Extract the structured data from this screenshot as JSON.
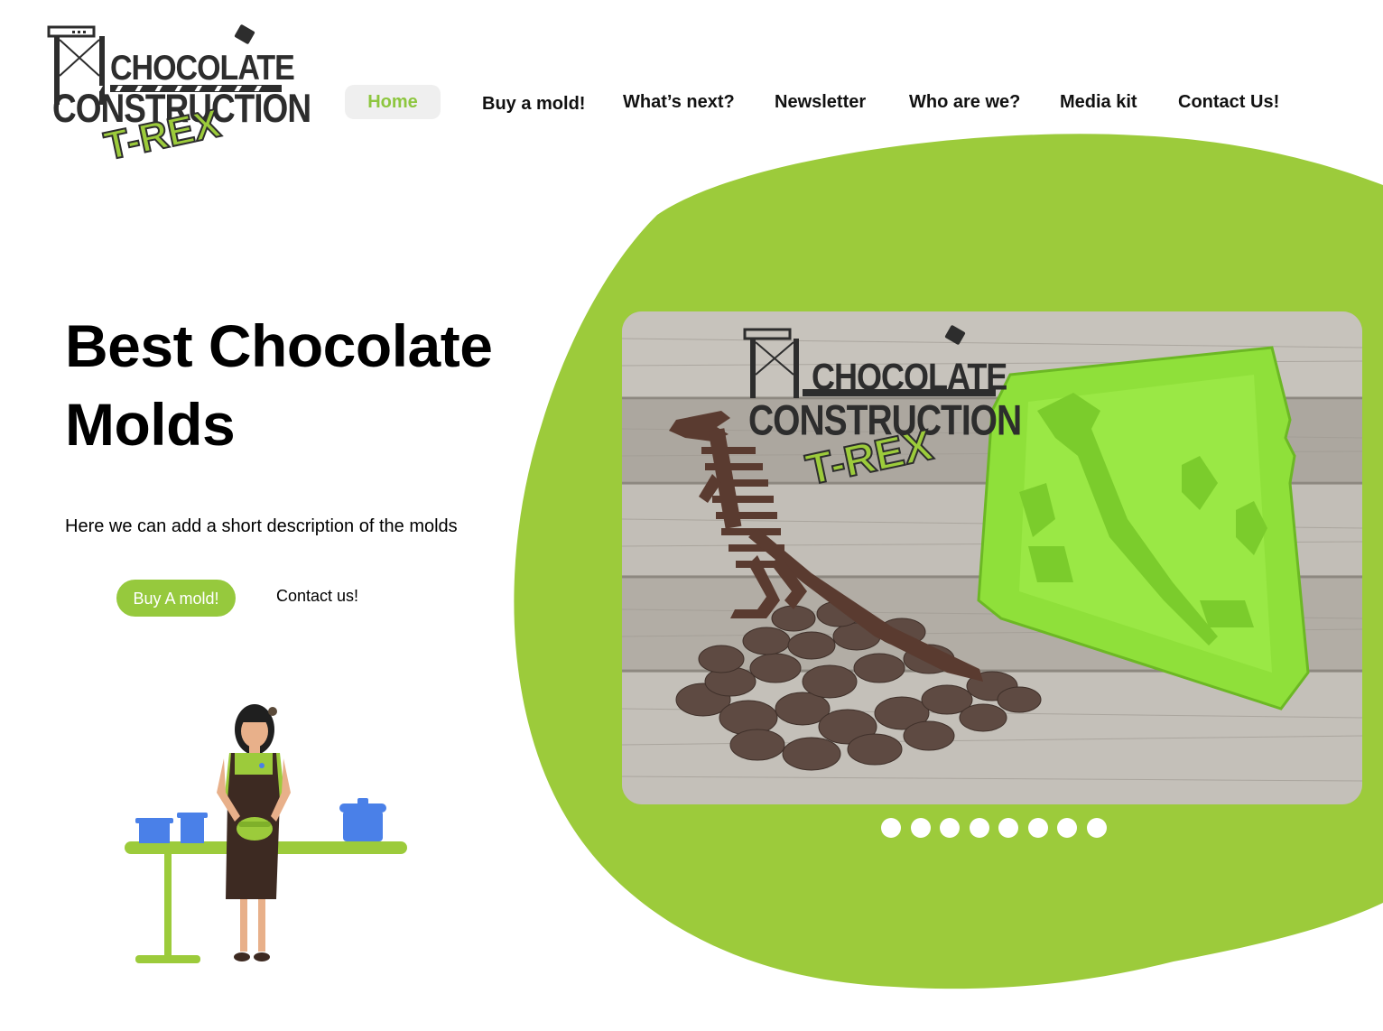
{
  "logo": {
    "line1": "CHOCOLATE",
    "line2": "CONSTRUCTION",
    "line3": "T-REX"
  },
  "nav": {
    "items": [
      {
        "label": "Home",
        "active": true
      },
      {
        "label": "Buy a mold!"
      },
      {
        "label": "What’s next?"
      },
      {
        "label": "Newsletter"
      },
      {
        "label": "Who are we?"
      },
      {
        "label": "Media kit"
      },
      {
        "label": "Contact Us!"
      }
    ]
  },
  "hero": {
    "title_line1": "Best Chocolate",
    "title_line2": "Molds",
    "description": "Here we can add a short description of the molds",
    "buy_button": "Buy A mold!",
    "contact_link": "Contact us!"
  },
  "slider": {
    "logo_line1": "CHOCOLATE",
    "logo_line2": "CONSTRUCTION",
    "logo_line3": "T-REX",
    "dot_count": 8
  },
  "colors": {
    "accent": "#9ccb3b",
    "button": "#96c93d",
    "nav_active_text": "#8dc63f",
    "nav_active_bg": "#efefef"
  },
  "icons": {
    "logo": "crane-logo-icon",
    "illustration": "woman-cooking-illustration"
  }
}
